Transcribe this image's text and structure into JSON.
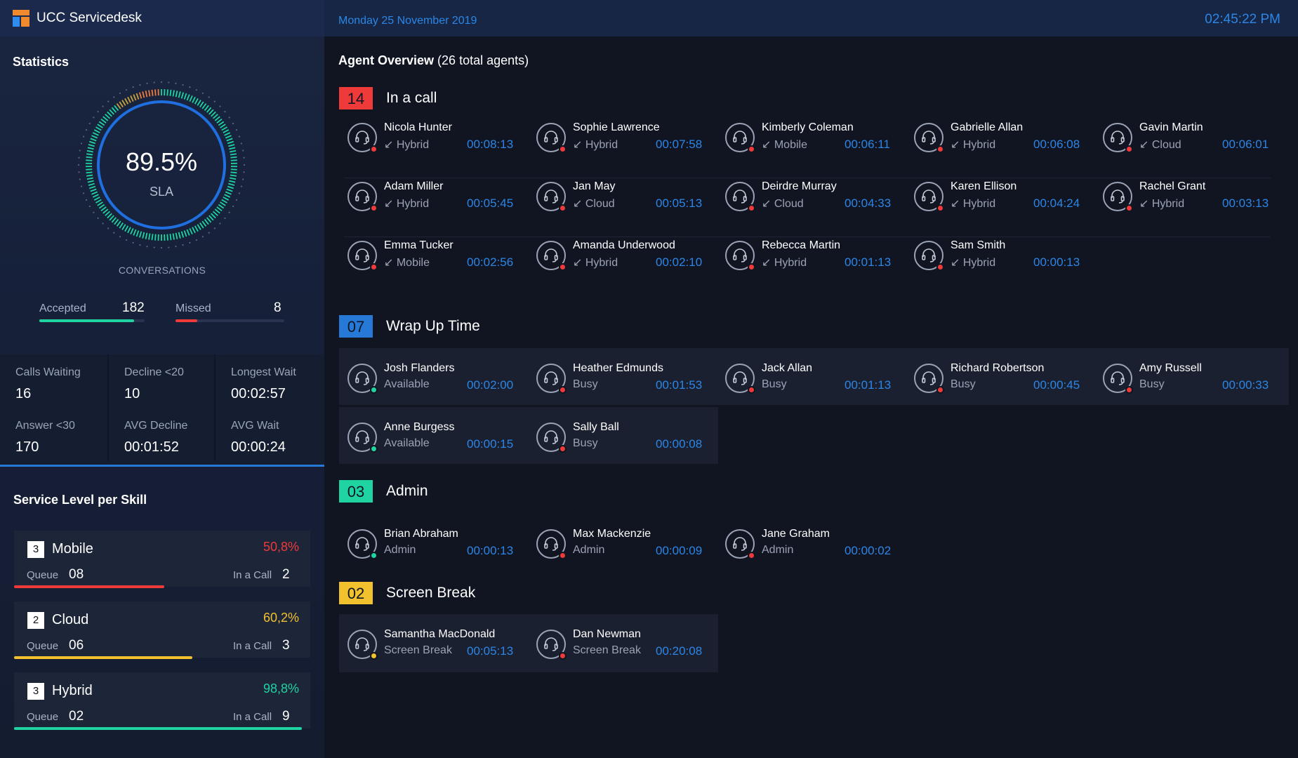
{
  "header": {
    "title": "UCC Servicedesk",
    "date": "Monday 25 November 2019",
    "time": "02:45:22 PM"
  },
  "statistics": {
    "title": "Statistics",
    "sla_value": "89.5%",
    "sla_label": "SLA",
    "sla_fraction": 0.895,
    "conversations_label": "CONVERSATIONS",
    "accepted_label": "Accepted",
    "accepted_value": "182",
    "missed_label": "Missed",
    "missed_value": "8",
    "kpis": [
      {
        "label": "Calls Waiting",
        "value": "16"
      },
      {
        "label": "Decline <20",
        "value": "10"
      },
      {
        "label": "Longest Wait",
        "value": "00:02:57"
      },
      {
        "label": "Answer <30",
        "value": "170"
      },
      {
        "label": "AVG Decline",
        "value": "00:01:52"
      },
      {
        "label": "AVG Wait",
        "value": "00:00:24"
      }
    ]
  },
  "service_level": {
    "title": "Service Level per Skill",
    "queue_label": "Queue",
    "in_call_label": "In a Call",
    "skills": [
      {
        "badge": "3",
        "name": "Mobile",
        "pct": "50,8%",
        "queue": "08",
        "in_call": "2",
        "color": "#ef3a3a",
        "fill": 0.508
      },
      {
        "badge": "2",
        "name": "Cloud",
        "pct": "60,2%",
        "queue": "06",
        "in_call": "3",
        "color": "#f2c12e",
        "fill": 0.602
      },
      {
        "badge": "3",
        "name": "Hybrid",
        "pct": "98,8%",
        "queue": "02",
        "in_call": "9",
        "color": "#1fd4a0",
        "fill": 0.988
      }
    ]
  },
  "overview": {
    "title_bold": "Agent Overview",
    "title_rest": " (26 total agents)",
    "groups": [
      {
        "count": "14",
        "name": "In a call",
        "color": "#ef3a3a",
        "agents": [
          {
            "name": "Nicola Hunter",
            "sub": "↙ Hybrid",
            "time": "00:08:13",
            "status": "red"
          },
          {
            "name": "Sophie Lawrence",
            "sub": "↙ Hybrid",
            "time": "00:07:58",
            "status": "red"
          },
          {
            "name": "Kimberly Coleman",
            "sub": "↙ Mobile",
            "time": "00:06:11",
            "status": "red"
          },
          {
            "name": "Gabrielle Allan",
            "sub": "↙ Hybrid",
            "time": "00:06:08",
            "status": "red"
          },
          {
            "name": "Gavin Martin",
            "sub": "↙ Cloud",
            "time": "00:06:01",
            "status": "red"
          },
          {
            "name": "Adam Miller",
            "sub": "↙ Hybrid",
            "time": "00:05:45",
            "status": "red"
          },
          {
            "name": "Jan May",
            "sub": "↙ Cloud",
            "time": "00:05:13",
            "status": "red"
          },
          {
            "name": "Deirdre Murray",
            "sub": "↙ Cloud",
            "time": "00:04:33",
            "status": "red"
          },
          {
            "name": "Karen Ellison",
            "sub": "↙ Hybrid",
            "time": "00:04:24",
            "status": "red"
          },
          {
            "name": "Rachel Grant",
            "sub": "↙ Hybrid",
            "time": "00:03:13",
            "status": "red"
          },
          {
            "name": "Emma Tucker",
            "sub": "↙ Mobile",
            "time": "00:02:56",
            "status": "red"
          },
          {
            "name": "Amanda Underwood",
            "sub": "↙ Hybrid",
            "time": "00:02:10",
            "status": "red"
          },
          {
            "name": "Rebecca Martin",
            "sub": "↙ Hybrid",
            "time": "00:01:13",
            "status": "red"
          },
          {
            "name": "Sam Smith",
            "sub": "↙ Hybrid",
            "time": "00:00:13",
            "status": "red"
          }
        ]
      },
      {
        "count": "07",
        "name": "Wrap Up Time",
        "color": "#2679d6",
        "agents": [
          {
            "name": "Josh Flanders",
            "sub": "Available",
            "time": "00:02:00",
            "status": "green"
          },
          {
            "name": "Heather Edmunds",
            "sub": "Busy",
            "time": "00:01:53",
            "status": "red"
          },
          {
            "name": "Jack Allan",
            "sub": "Busy",
            "time": "00:01:13",
            "status": "red"
          },
          {
            "name": "Richard Robertson",
            "sub": "Busy",
            "time": "00:00:45",
            "status": "red"
          },
          {
            "name": "Amy Russell",
            "sub": "Busy",
            "time": "00:00:33",
            "status": "red"
          },
          {
            "name": "Anne Burgess",
            "sub": "Available",
            "time": "00:00:15",
            "status": "green"
          },
          {
            "name": "Sally Ball",
            "sub": "Busy",
            "time": "00:00:08",
            "status": "red"
          }
        ]
      },
      {
        "count": "03",
        "name": "Admin",
        "color": "#1fd4a0",
        "agents": [
          {
            "name": "Brian Abraham",
            "sub": "Admin",
            "time": "00:00:13",
            "status": "green"
          },
          {
            "name": "Max Mackenzie",
            "sub": "Admin",
            "time": "00:00:09",
            "status": "red"
          },
          {
            "name": "Jane Graham",
            "sub": "Admin",
            "time": "00:00:02",
            "status": "red"
          }
        ]
      },
      {
        "count": "02",
        "name": "Screen Break",
        "color": "#f2c12e",
        "agents": [
          {
            "name": "Samantha MacDonald",
            "sub": "Screen Break",
            "time": "00:05:13",
            "status": "yellow"
          },
          {
            "name": "Dan Newman",
            "sub": "Screen Break",
            "time": "00:20:08",
            "status": "red"
          }
        ]
      }
    ]
  }
}
